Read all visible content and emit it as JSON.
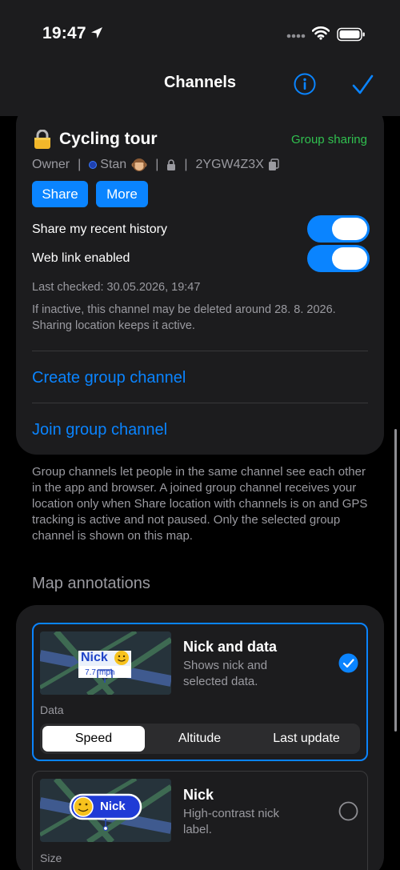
{
  "status": {
    "time": "19:47"
  },
  "nav": {
    "title": "Channels"
  },
  "channel": {
    "title": "Cycling tour",
    "badge": "Group sharing",
    "role": "Owner",
    "member": "Stan",
    "code": "2YGW4Z3X",
    "share_label": "Share",
    "more_label": "More",
    "history_label": "Share my recent history",
    "history_on": true,
    "weblink_label": "Web link enabled",
    "weblink_on": true,
    "last_checked": "Last checked: 30.05.2026, 19:47",
    "inactive_note": "If inactive, this channel may be deleted around 28. 8. 2026. Sharing location keeps it active."
  },
  "links": {
    "create": "Create group channel",
    "join": "Join group channel"
  },
  "explain": "Group channels let people in the same channel see each other in the app and browser. A joined group channel receives your location only when Share location with channels is on and GPS tracking is active and not paused. Only the selected group channel is shown on this map.",
  "annotations": {
    "title": "Map annotations",
    "options": [
      {
        "name": "Nick and data",
        "desc": "Shows nick and selected data.",
        "selected": true,
        "preview_nick": "Nick",
        "preview_value": "7.7",
        "preview_unit": "mph",
        "sub_label": "Data",
        "segments": [
          "Speed",
          "Altitude",
          "Last update"
        ],
        "segment_selected": "Speed"
      },
      {
        "name": "Nick",
        "desc": "High-contrast nick label.",
        "selected": false,
        "preview_nick": "Nick",
        "sub_label": "Size"
      }
    ]
  },
  "colors": {
    "accent": "#0a84ff",
    "green": "#30c04f",
    "card": "#1c1c1e"
  }
}
